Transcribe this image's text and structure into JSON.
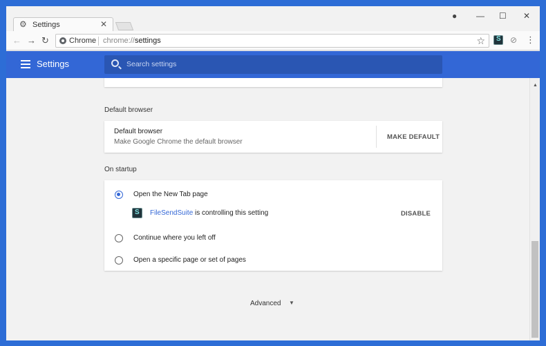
{
  "tab": {
    "title": "Settings",
    "close": "✕"
  },
  "window_controls": {
    "profile": "●",
    "minimize": "—",
    "maximize": "☐",
    "close": "✕"
  },
  "toolbar": {
    "back": "←",
    "forward": "→",
    "reload": "↻",
    "chip_label": "Chrome",
    "url_scheme": "chrome://",
    "url_path": "settings",
    "star": "☆",
    "menu": "⋮",
    "link_ext": "⊘"
  },
  "header": {
    "title": "Settings",
    "search_placeholder": "Search settings"
  },
  "sections": {
    "default_browser": {
      "label": "Default browser",
      "title": "Default browser",
      "subtitle": "Make Google Chrome the default browser",
      "button": "MAKE DEFAULT"
    },
    "on_startup": {
      "label": "On startup",
      "options": [
        {
          "label": "Open the New Tab page",
          "checked": true
        },
        {
          "label": "Continue where you left off",
          "checked": false
        },
        {
          "label": "Open a specific page or set of pages",
          "checked": false
        }
      ],
      "controlled_by": {
        "extension": "FileSendSuite",
        "text": " is controlling this setting",
        "button": "DISABLE"
      }
    }
  },
  "advanced": {
    "label": "Advanced",
    "arrow": "▼"
  },
  "icons": {
    "tab": "gear-icon",
    "profile": "profile-icon",
    "extension": "filesendsuite-icon",
    "menu": "hamburger-icon",
    "search": "search-icon"
  },
  "colors": {
    "header": "#3367d6",
    "accent": "#3367d6",
    "frame": "#2d6dd6"
  }
}
